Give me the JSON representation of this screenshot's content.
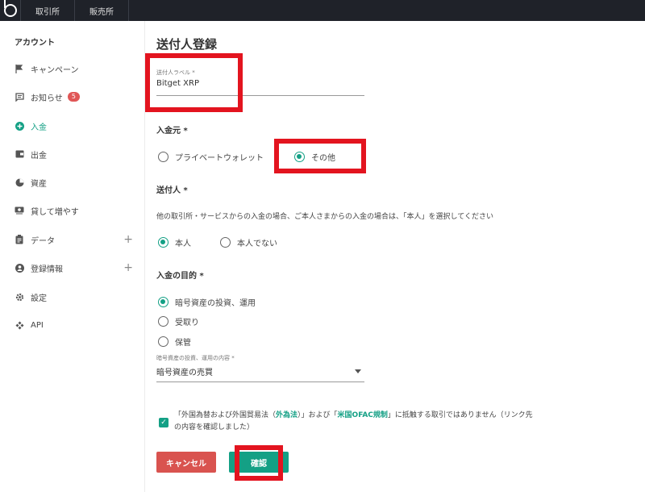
{
  "topbar": {
    "tabs": [
      "取引所",
      "販売所"
    ]
  },
  "sidebar": {
    "title": "アカウント",
    "items": [
      {
        "label": "キャンペーン",
        "icon": "flag-icon"
      },
      {
        "label": "お知らせ",
        "icon": "message-icon",
        "badge": "5"
      },
      {
        "label": "入金",
        "icon": "plus-circle-icon"
      },
      {
        "label": "出金",
        "icon": "wallet-icon"
      },
      {
        "label": "資産",
        "icon": "pie-chart-icon"
      },
      {
        "label": "貸して増やす",
        "icon": "lend-icon"
      },
      {
        "label": "データ",
        "icon": "clipboard-icon"
      },
      {
        "label": "登録情報",
        "icon": "user-circle-icon"
      },
      {
        "label": "設定",
        "icon": "gear-icon"
      },
      {
        "label": "API",
        "icon": "api-icon"
      }
    ]
  },
  "form": {
    "title": "送付人登録",
    "sender_label": {
      "label": "送付人ラベル *",
      "value": "Bitget XRP"
    },
    "source": {
      "label": "入金元 *",
      "options": [
        "プライベートウォレット",
        "その他"
      ],
      "selected": "その他"
    },
    "sender": {
      "label": "送付人 *",
      "description": "他の取引所・サービスからの入金の場合、ご本人さまからの入金の場合は、「本人」を選択してください",
      "options": [
        "本人",
        "本人でない"
      ],
      "selected": "本人"
    },
    "purpose": {
      "label": "入金の目的 *",
      "options": [
        "暗号資産の投資、運用",
        "受取り",
        "保管"
      ],
      "selected": "暗号資産の投資、運用"
    },
    "purpose_detail": {
      "label": "暗号資産の投資、運用の内容 *",
      "value": "暗号資産の売買"
    },
    "agreement": {
      "part1": "「外国為替および外国貿易法（",
      "link1": "外為法",
      "part2": "）」および「",
      "link2": "米国OFAC規制",
      "part3": "」に抵触する取引ではありません（リンク先",
      "line2": "の内容を確認しました）",
      "checked": true
    },
    "buttons": {
      "cancel": "キャンセル",
      "confirm": "確認"
    }
  },
  "colors": {
    "accent": "#14a085",
    "danger": "#d9534f",
    "highlight": "#e3141f",
    "topbar": "#1f2229"
  }
}
